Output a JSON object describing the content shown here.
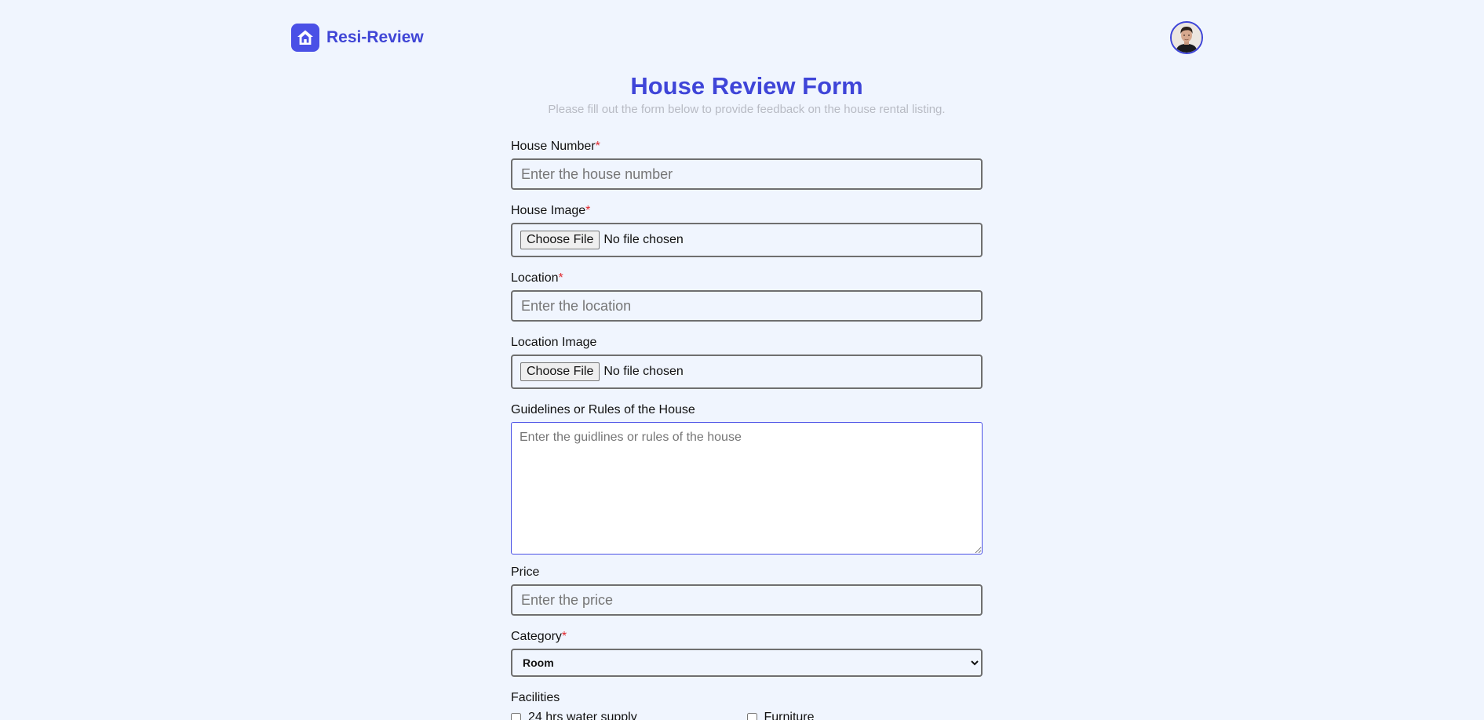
{
  "header": {
    "brand": "Resi-Review",
    "logo_icon": "house-icon",
    "avatar_icon": "user-avatar"
  },
  "page": {
    "title": "House Review Form",
    "subtitle": "Please fill out the form below to provide feedback on the house rental listing."
  },
  "form": {
    "required_mark": "*",
    "house_number": {
      "label": "House Number",
      "placeholder": "Enter the house number"
    },
    "house_image": {
      "label": "House Image",
      "button": "Choose File",
      "status": "No file chosen"
    },
    "location": {
      "label": "Location",
      "placeholder": "Enter the location"
    },
    "location_image": {
      "label": "Location Image",
      "button": "Choose File",
      "status": "No file chosen"
    },
    "guidelines": {
      "label": "Guidelines or Rules of the House",
      "placeholder": "Enter the guidlines or rules of the house"
    },
    "price": {
      "label": "Price",
      "placeholder": "Enter the price"
    },
    "category": {
      "label": "Category",
      "selected": "Room"
    },
    "facilities": {
      "label": "Facilities",
      "items": [
        {
          "label": "24 hrs water supply",
          "checked": false
        },
        {
          "label": "Furniture",
          "checked": false
        }
      ]
    }
  },
  "colors": {
    "accent": "#4a50e6",
    "title": "#3f45d8",
    "background": "#f0f5fe",
    "required": "#e0282e"
  }
}
